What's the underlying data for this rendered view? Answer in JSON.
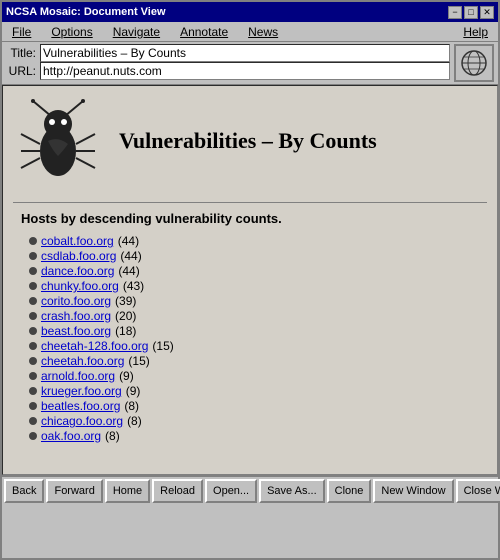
{
  "window": {
    "title": "NCSA Mosaic: Document View",
    "controls": [
      "−",
      "□",
      "✕"
    ]
  },
  "menu": {
    "items": [
      "File",
      "Options",
      "Navigate",
      "Annotate",
      "News",
      "Help"
    ]
  },
  "titlebar": {
    "label": "Title:",
    "value": "Vulnerabilities – By Counts"
  },
  "urlbar": {
    "label": "URL:",
    "value": "http://peanut.nuts.com"
  },
  "page": {
    "heading": "Vulnerabilities – By Counts",
    "subtitle": "Hosts by descending vulnerability counts.",
    "hosts": [
      {
        "name": "cobalt.foo.org",
        "count": "(44)"
      },
      {
        "name": "csdlab.foo.org",
        "count": "(44)"
      },
      {
        "name": "dance.foo.org",
        "count": "(44)"
      },
      {
        "name": "chunky.foo.org",
        "count": "(43)"
      },
      {
        "name": "corito.foo.org",
        "count": "(39)"
      },
      {
        "name": "crash.foo.org",
        "count": "(20)"
      },
      {
        "name": "beast.foo.org",
        "count": "(18)"
      },
      {
        "name": "cheetah-128.foo.org",
        "count": "(15)"
      },
      {
        "name": "cheetah.foo.org",
        "count": "(15)"
      },
      {
        "name": "arnold.foo.org",
        "count": "(9)"
      },
      {
        "name": "krueger.foo.org",
        "count": "(9)"
      },
      {
        "name": "beatles.foo.org",
        "count": "(8)"
      },
      {
        "name": "chicago.foo.org",
        "count": "(8)"
      },
      {
        "name": "oak.foo.org",
        "count": "(8)"
      }
    ]
  },
  "toolbar": {
    "buttons": [
      "Back",
      "Forward",
      "Home",
      "Reload",
      "Open...",
      "Save As...",
      "Clone",
      "New Window",
      "Close Window"
    ]
  }
}
